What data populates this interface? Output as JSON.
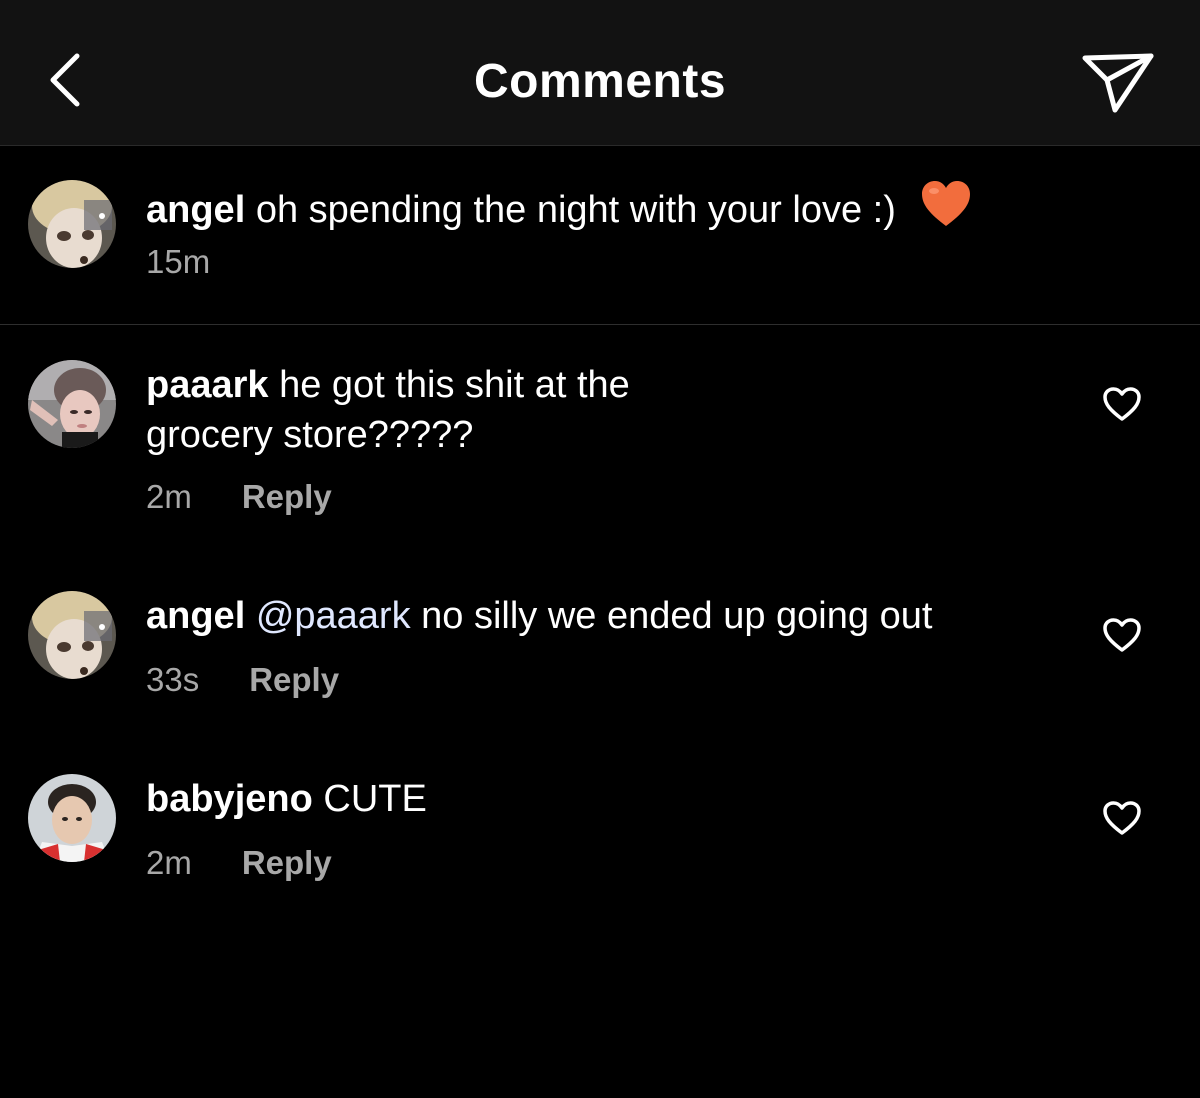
{
  "header": {
    "title": "Comments",
    "back_icon": "chevron-left-icon",
    "send_icon": "paper-plane-icon"
  },
  "caption": {
    "username": "angel",
    "text": "oh spending the night with your love :)",
    "emoji": "orange-heart",
    "time": "15m"
  },
  "comments": [
    {
      "username": "paaark",
      "text_line1": "he got this shit at the",
      "text_line2": "grocery store?????",
      "time": "2m",
      "reply_label": "Reply"
    },
    {
      "username": "angel",
      "mention": "@paaark",
      "text": "no silly we ended up going out",
      "time": "33s",
      "reply_label": "Reply"
    },
    {
      "username": "babyjeno",
      "text": "CUTE",
      "time": "2m",
      "reply_label": "Reply"
    }
  ],
  "colors": {
    "background": "#000000",
    "header_bg": "#121212",
    "primary_text": "#ffffff",
    "secondary_text": "#a8a8a8",
    "emoji_heart": "#f26d3d"
  }
}
